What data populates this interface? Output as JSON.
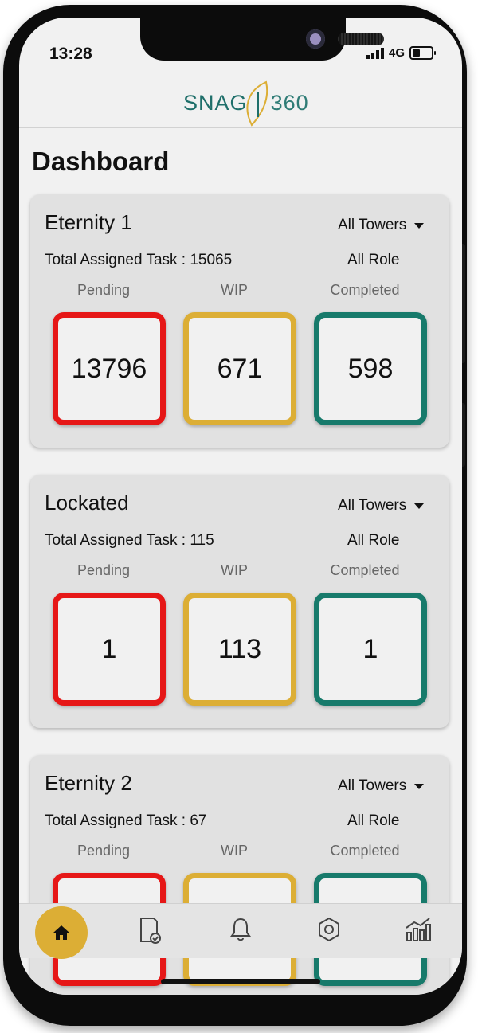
{
  "status": {
    "time": "13:28",
    "network": "4G"
  },
  "header": {
    "logo_text": "SNAG",
    "logo_number": "360"
  },
  "page": {
    "title": "Dashboard"
  },
  "cards": [
    {
      "name": "Eternity 1",
      "tower_filter": "All Towers",
      "total_label": "Total Assigned Task : 15065",
      "role_filter": "All Role",
      "labels": {
        "pending": "Pending",
        "wip": "WIP",
        "completed": "Completed"
      },
      "pending": "13796",
      "wip": "671",
      "completed": "598"
    },
    {
      "name": "Lockated",
      "tower_filter": "All Towers",
      "total_label": "Total Assigned Task : 115",
      "role_filter": "All Role",
      "labels": {
        "pending": "Pending",
        "wip": "WIP",
        "completed": "Completed"
      },
      "pending": "1",
      "wip": "113",
      "completed": "1"
    },
    {
      "name": "Eternity 2",
      "tower_filter": "All Towers",
      "total_label": "Total Assigned Task : 67",
      "role_filter": "All Role",
      "labels": {
        "pending": "Pending",
        "wip": "WIP",
        "completed": "Completed"
      },
      "pending": "",
      "wip": "",
      "completed": ""
    }
  ],
  "nav": {
    "items": [
      {
        "icon": "home-icon",
        "active": true
      },
      {
        "icon": "task-check-icon",
        "active": false
      },
      {
        "icon": "bell-icon",
        "active": false
      },
      {
        "icon": "hexagon-settings-icon",
        "active": false
      },
      {
        "icon": "bar-chart-icon",
        "active": false
      }
    ]
  },
  "colors": {
    "pending": "#e61717",
    "wip": "#dcae35",
    "completed": "#177a6b",
    "accent": "#dcae35"
  }
}
